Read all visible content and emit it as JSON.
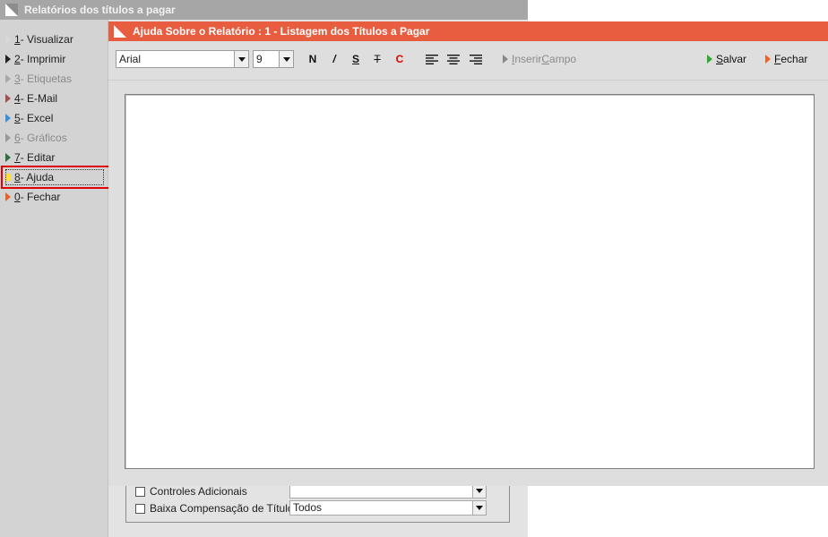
{
  "background_window": {
    "title": "Relatórios dos títulos a pagar",
    "menu": [
      {
        "key": "1",
        "label": " - Visualizar",
        "icon_color": "#d0d0d0",
        "disabled": false
      },
      {
        "key": "2",
        "label": " - Imprimir",
        "icon_color": "#222222",
        "disabled": false
      },
      {
        "key": "3",
        "label": " - Etiquetas",
        "icon_color": "#aaaaaa",
        "disabled": true
      },
      {
        "key": "4",
        "label": " - E-Mail",
        "icon_color": "#a05050",
        "disabled": false
      },
      {
        "key": "5",
        "label": " - Excel",
        "icon_color": "#3d8fd6",
        "disabled": false
      },
      {
        "key": "6",
        "label": " - Gráficos",
        "icon_color": "#999999",
        "disabled": true
      },
      {
        "key": "7",
        "label": " - Editar",
        "icon_color": "#2e6b4a",
        "disabled": false
      },
      {
        "key": "8",
        "label": " - Ajuda",
        "icon_color": "#ffe03a",
        "disabled": false,
        "selected": true
      },
      {
        "key": "0",
        "label": " - Fechar",
        "icon_color": "#e8622a",
        "disabled": false
      }
    ],
    "options": [
      {
        "label": "Controles Adicionais",
        "checked": false,
        "value": ""
      },
      {
        "label": "Baixa Compensação de Título",
        "checked": false,
        "value": "Todos"
      }
    ]
  },
  "dialog": {
    "title": "Ajuda Sobre o Relatório : 1 - Listagem dos Títulos a Pagar",
    "title_color": "#e85c3f",
    "toolbar": {
      "font_name": "Arial",
      "font_size": "9",
      "bold": "N",
      "italic": "/",
      "strike_s": "S",
      "strike_t": "T",
      "color": "C",
      "insert_field": {
        "accel": "I",
        "text": "nserir ",
        "accel2": "C",
        "text2": "ampo"
      },
      "save": {
        "accel": "S",
        "text": "alvar"
      },
      "close": {
        "accel": "F",
        "text": "echar"
      }
    },
    "editor_content": ""
  },
  "colors": {
    "highlight_border": "#e00000",
    "save_icon": "#2fa92f",
    "close_icon": "#e8622a",
    "color_button": "#e00000"
  }
}
